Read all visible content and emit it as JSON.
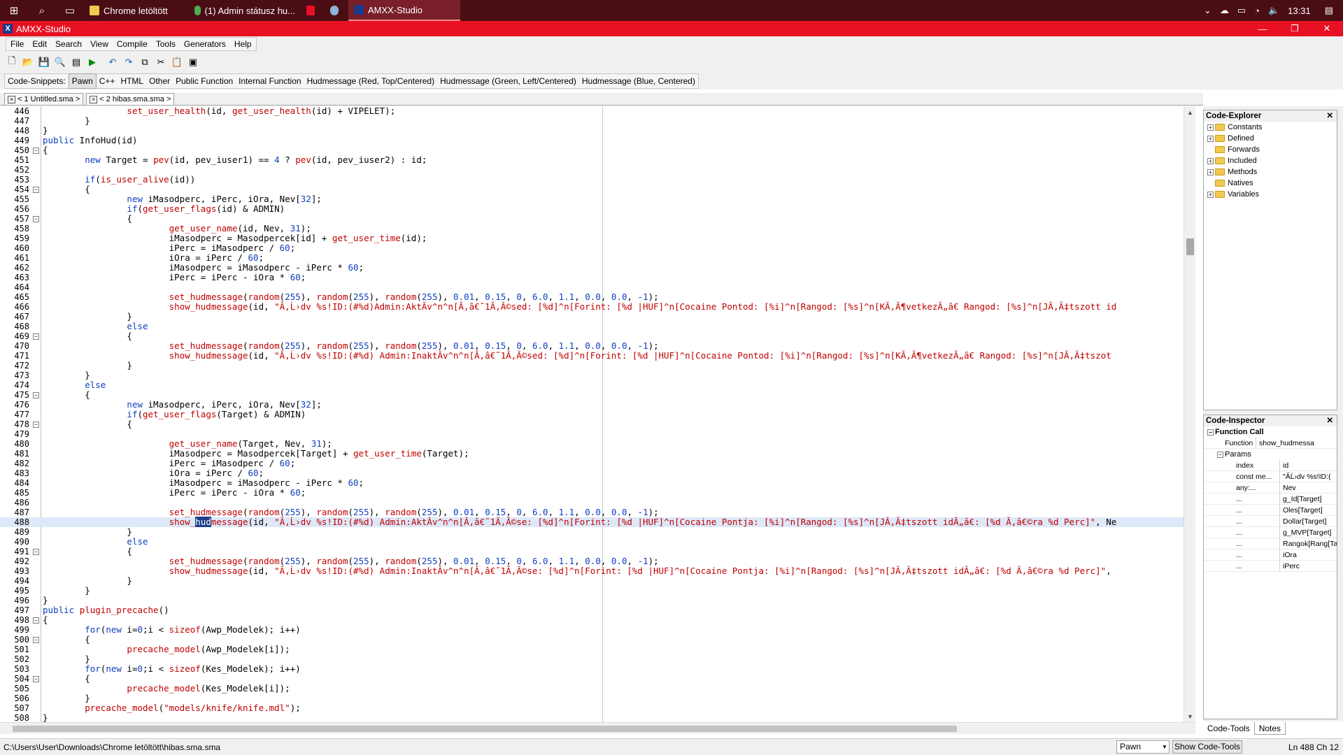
{
  "taskbar": {
    "tasks": [
      {
        "label": "Chrome letöltött",
        "color": "#f2c94c"
      },
      {
        "label": "(1) Admin státusz hu...",
        "color": "#4caf50"
      },
      {
        "label": "",
        "color": "#e81123"
      },
      {
        "label": "",
        "color": "#1b2838"
      },
      {
        "label": "AMXX-Studio",
        "color": "#1a3a8a"
      }
    ],
    "clock": "13:31"
  },
  "window": {
    "title": "AMXX-Studio"
  },
  "menu": [
    "File",
    "Edit",
    "Search",
    "View",
    "Compile",
    "Tools",
    "Generators",
    "Help"
  ],
  "snippets": {
    "label": "Code-Snippets:",
    "items": [
      "Pawn",
      "C++",
      "HTML",
      "Other",
      "Public Function",
      "Internal Function",
      "Hudmessage (Red, Top/Centered)",
      "Hudmessage (Green, Left/Centered)",
      "Hudmessage (Blue, Centered)"
    ]
  },
  "file_tabs": [
    "< 1 Untitled.sma >",
    "< 2 hibas.sma.sma >"
  ],
  "editor": {
    "current_line": 488,
    "selected_word": "hud",
    "lines": [
      {
        "n": 446,
        "fold": "",
        "code": "\t\tset_user_health(id, get_user_health(id) + VIPELET);"
      },
      {
        "n": 447,
        "fold": "",
        "code": "\t}"
      },
      {
        "n": 448,
        "fold": "",
        "code": "}"
      },
      {
        "n": 449,
        "fold": "",
        "code": "public InfoHud(id)"
      },
      {
        "n": 450,
        "fold": "-",
        "code": "{"
      },
      {
        "n": 451,
        "fold": "",
        "code": "\tnew Target = pev(id, pev_iuser1) == 4 ? pev(id, pev_iuser2) : id;"
      },
      {
        "n": 452,
        "fold": "",
        "code": ""
      },
      {
        "n": 453,
        "fold": "",
        "code": "\tif(is_user_alive(id))"
      },
      {
        "n": 454,
        "fold": "-",
        "code": "\t{"
      },
      {
        "n": 455,
        "fold": "",
        "code": "\t\tnew iMasodperc, iPerc, iOra, Nev[32];"
      },
      {
        "n": 456,
        "fold": "",
        "code": "\t\tif(get_user_flags(id) & ADMIN)"
      },
      {
        "n": 457,
        "fold": "-",
        "code": "\t\t{"
      },
      {
        "n": 458,
        "fold": "",
        "code": "\t\t\tget_user_name(id, Nev, 31);"
      },
      {
        "n": 459,
        "fold": "",
        "code": "\t\t\tiMasodperc = Masodpercek[id] + get_user_time(id);"
      },
      {
        "n": 460,
        "fold": "",
        "code": "\t\t\tiPerc = iMasodperc / 60;"
      },
      {
        "n": 461,
        "fold": "",
        "code": "\t\t\tiOra = iPerc / 60;"
      },
      {
        "n": 462,
        "fold": "",
        "code": "\t\t\tiMasodperc = iMasodperc - iPerc * 60;"
      },
      {
        "n": 463,
        "fold": "",
        "code": "\t\t\tiPerc = iPerc - iOra * 60;"
      },
      {
        "n": 464,
        "fold": "",
        "code": ""
      },
      {
        "n": 465,
        "fold": "",
        "code": "\t\t\tset_hudmessage(random(255), random(255), random(255), 0.01, 0.15, 0, 6.0, 1.1, 0.0, 0.0, -1);"
      },
      {
        "n": 466,
        "fold": "",
        "code": "\t\t\tshow_hudmessage(id, \"Ă‚Ĺ›dv %s!ID:(#%d)Admin:AktĂ­v^n^n[Ă‚â€˜1Ă‚Ă©sed: [%d]^n[Forint: [%d |HUF]^n[Cocaine Pontod: [%i]^n[Rangod: [%s]^n[KĂ‚Ă¶vetkezĂ„â€ Rangod: [%s]^n[JĂ‚Ä‡tszott id"
      },
      {
        "n": 467,
        "fold": "",
        "code": "\t\t}"
      },
      {
        "n": 468,
        "fold": "",
        "code": "\t\telse"
      },
      {
        "n": 469,
        "fold": "-",
        "code": "\t\t{"
      },
      {
        "n": 470,
        "fold": "",
        "code": "\t\t\tset_hudmessage(random(255), random(255), random(255), 0.01, 0.15, 0, 6.0, 1.1, 0.0, 0.0, -1);"
      },
      {
        "n": 471,
        "fold": "",
        "code": "\t\t\tshow_hudmessage(id, \"Ă‚Ĺ›dv %s!ID:(#%d) Admin:InaktĂ­v^n^n[Ă‚â€˜1Ă‚Ă©sed: [%d]^n[Forint: [%d |HUF]^n[Cocaine Pontod: [%i]^n[Rangod: [%s]^n[KĂ‚Ă¶vetkezĂ„â€ Rangod: [%s]^n[JĂ‚Ä‡tszot"
      },
      {
        "n": 472,
        "fold": "",
        "code": "\t\t}"
      },
      {
        "n": 473,
        "fold": "",
        "code": "\t}"
      },
      {
        "n": 474,
        "fold": "",
        "code": "\telse"
      },
      {
        "n": 475,
        "fold": "-",
        "code": "\t{"
      },
      {
        "n": 476,
        "fold": "",
        "code": "\t\tnew iMasodperc, iPerc, iOra, Nev[32];"
      },
      {
        "n": 477,
        "fold": "",
        "code": "\t\tif(get_user_flags(Target) & ADMIN)"
      },
      {
        "n": 478,
        "fold": "-",
        "code": "\t\t{"
      },
      {
        "n": 479,
        "fold": "",
        "code": ""
      },
      {
        "n": 480,
        "fold": "",
        "code": "\t\t\tget_user_name(Target, Nev, 31);"
      },
      {
        "n": 481,
        "fold": "",
        "code": "\t\t\tiMasodperc = Masodpercek[Target] + get_user_time(Target);"
      },
      {
        "n": 482,
        "fold": "",
        "code": "\t\t\tiPerc = iMasodperc / 60;"
      },
      {
        "n": 483,
        "fold": "",
        "code": "\t\t\tiOra = iPerc / 60;"
      },
      {
        "n": 484,
        "fold": "",
        "code": "\t\t\tiMasodperc = iMasodperc - iPerc * 60;"
      },
      {
        "n": 485,
        "fold": "",
        "code": "\t\t\tiPerc = iPerc - iOra * 60;"
      },
      {
        "n": 486,
        "fold": "",
        "code": ""
      },
      {
        "n": 487,
        "fold": "",
        "code": "\t\t\tset_hudmessage(random(255), random(255), random(255), 0.01, 0.15, 0, 6.0, 1.1, 0.0, 0.0, -1);"
      },
      {
        "n": 488,
        "fold": "",
        "code": "\t\t\tshow_hudmessage(id, \"Ă‚Ĺ›dv %s!ID:(#%d) Admin:AktĂ­v^n^n[Ă‚â€˜1Ă‚Ă©se: [%d]^n[Forint: [%d |HUF]^n[Cocaine Pontja: [%i]^n[Rangod: [%s]^n[JĂ‚Ä‡tszott idĂ„â€: [%d Ă‚â€©ra %d Perc]\", Ne"
      },
      {
        "n": 489,
        "fold": "",
        "code": "\t\t}"
      },
      {
        "n": 490,
        "fold": "",
        "code": "\t\telse"
      },
      {
        "n": 491,
        "fold": "-",
        "code": "\t\t{"
      },
      {
        "n": 492,
        "fold": "",
        "code": "\t\t\tset_hudmessage(random(255), random(255), random(255), 0.01, 0.15, 0, 6.0, 1.1, 0.0, 0.0, -1);"
      },
      {
        "n": 493,
        "fold": "",
        "code": "\t\t\tshow_hudmessage(id, \"Ă‚Ĺ›dv %s!ID:(#%d) Admin:InaktĂ­v^n^n[Ă‚â€˜1Ă‚Ă©se: [%d]^n[Forint: [%d |HUF]^n[Cocaine Pontja: [%i]^n[Rangod: [%s]^n[JĂ‚Ä‡tszott idĂ„â€: [%d Ă‚â€©ra %d Perc]\","
      },
      {
        "n": 494,
        "fold": "",
        "code": "\t\t}"
      },
      {
        "n": 495,
        "fold": "",
        "code": "\t}"
      },
      {
        "n": 496,
        "fold": "",
        "code": "}"
      },
      {
        "n": 497,
        "fold": "",
        "code": "public plugin_precache()"
      },
      {
        "n": 498,
        "fold": "-",
        "code": "{"
      },
      {
        "n": 499,
        "fold": "",
        "code": "\tfor(new i=0;i < sizeof(Awp_Modelek); i++)"
      },
      {
        "n": 500,
        "fold": "-",
        "code": "\t{"
      },
      {
        "n": 501,
        "fold": "",
        "code": "\t\tprecache_model(Awp_Modelek[i]);"
      },
      {
        "n": 502,
        "fold": "",
        "code": "\t}"
      },
      {
        "n": 503,
        "fold": "",
        "code": "\tfor(new i=0;i < sizeof(Kes_Modelek); i++)"
      },
      {
        "n": 504,
        "fold": "-",
        "code": "\t{"
      },
      {
        "n": 505,
        "fold": "",
        "code": "\t\tprecache_model(Kes_Modelek[i]);"
      },
      {
        "n": 506,
        "fold": "",
        "code": "\t}"
      },
      {
        "n": 507,
        "fold": "",
        "code": "\tprecache_model(\"models/knife/knife.mdl\");"
      },
      {
        "n": 508,
        "fold": "",
        "code": "}"
      }
    ]
  },
  "code_explorer": {
    "title": "Code-Explorer",
    "items": [
      {
        "label": "Constants",
        "expandable": true
      },
      {
        "label": "Defined",
        "expandable": true
      },
      {
        "label": "Forwards",
        "expandable": false
      },
      {
        "label": "Included",
        "expandable": true
      },
      {
        "label": "Methods",
        "expandable": true
      },
      {
        "label": "Natives",
        "expandable": false
      },
      {
        "label": "Variables",
        "expandable": true
      }
    ]
  },
  "code_inspector": {
    "title": "Code-Inspector",
    "group": "Function Call",
    "function_label": "Function",
    "function_value": "show_hudmessa",
    "params_label": "Params",
    "params": [
      {
        "name": "index",
        "value": "id"
      },
      {
        "name": "const me...",
        "value": "\"ĂĹ›dv %s!ID:("
      },
      {
        "name": "any:...",
        "value": "Nev"
      },
      {
        "name": "...",
        "value": "g_Id[Target]"
      },
      {
        "name": "...",
        "value": "Oles[Target]"
      },
      {
        "name": "...",
        "value": "Dollar[Target]"
      },
      {
        "name": "...",
        "value": "g_MVP[Target]"
      },
      {
        "name": "...",
        "value": "Rangok[Rang[Ta"
      },
      {
        "name": "...",
        "value": "iOra"
      },
      {
        "name": "...",
        "value": "iPerc"
      }
    ]
  },
  "bottom_tabs": [
    "Code-Tools",
    "Notes"
  ],
  "status": {
    "path": "C:\\Users\\User\\Downloads\\Chrome letöltött\\hibas.sma.sma",
    "language": "Pawn",
    "toggle_button": "Show Code-Tools",
    "position": "Ln 488 Ch 12"
  }
}
